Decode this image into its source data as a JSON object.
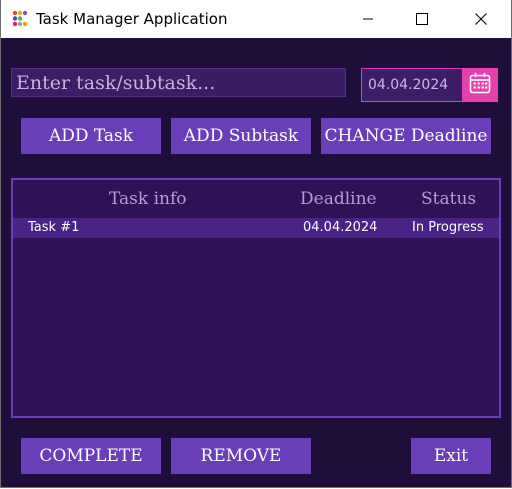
{
  "window": {
    "title": "Task Manager Application",
    "icon": "app-dots-icon",
    "controls": [
      "minimize-icon",
      "maximize-icon",
      "close-icon"
    ]
  },
  "input": {
    "placeholder": "Enter task/subtask...",
    "value": ""
  },
  "date": {
    "value": "04.04.2024",
    "icon": "calendar-icon"
  },
  "actions": {
    "add_task": "ADD Task",
    "add_subtask": "ADD Subtask",
    "change_deadline": "CHANGE Deadline"
  },
  "table": {
    "columns": [
      "Task info",
      "Deadline",
      "Status"
    ],
    "rows": [
      {
        "task": "Task #1",
        "deadline": "04.04.2024",
        "status": "In Progress"
      }
    ]
  },
  "footer": {
    "complete": "COMPLETE",
    "remove": "REMOVE",
    "exit": "Exit"
  },
  "colors": {
    "background": "#200e3a",
    "button": "#6a3eb8",
    "calendar_accent": "#e640ad",
    "selected_row": "#4a2185"
  }
}
